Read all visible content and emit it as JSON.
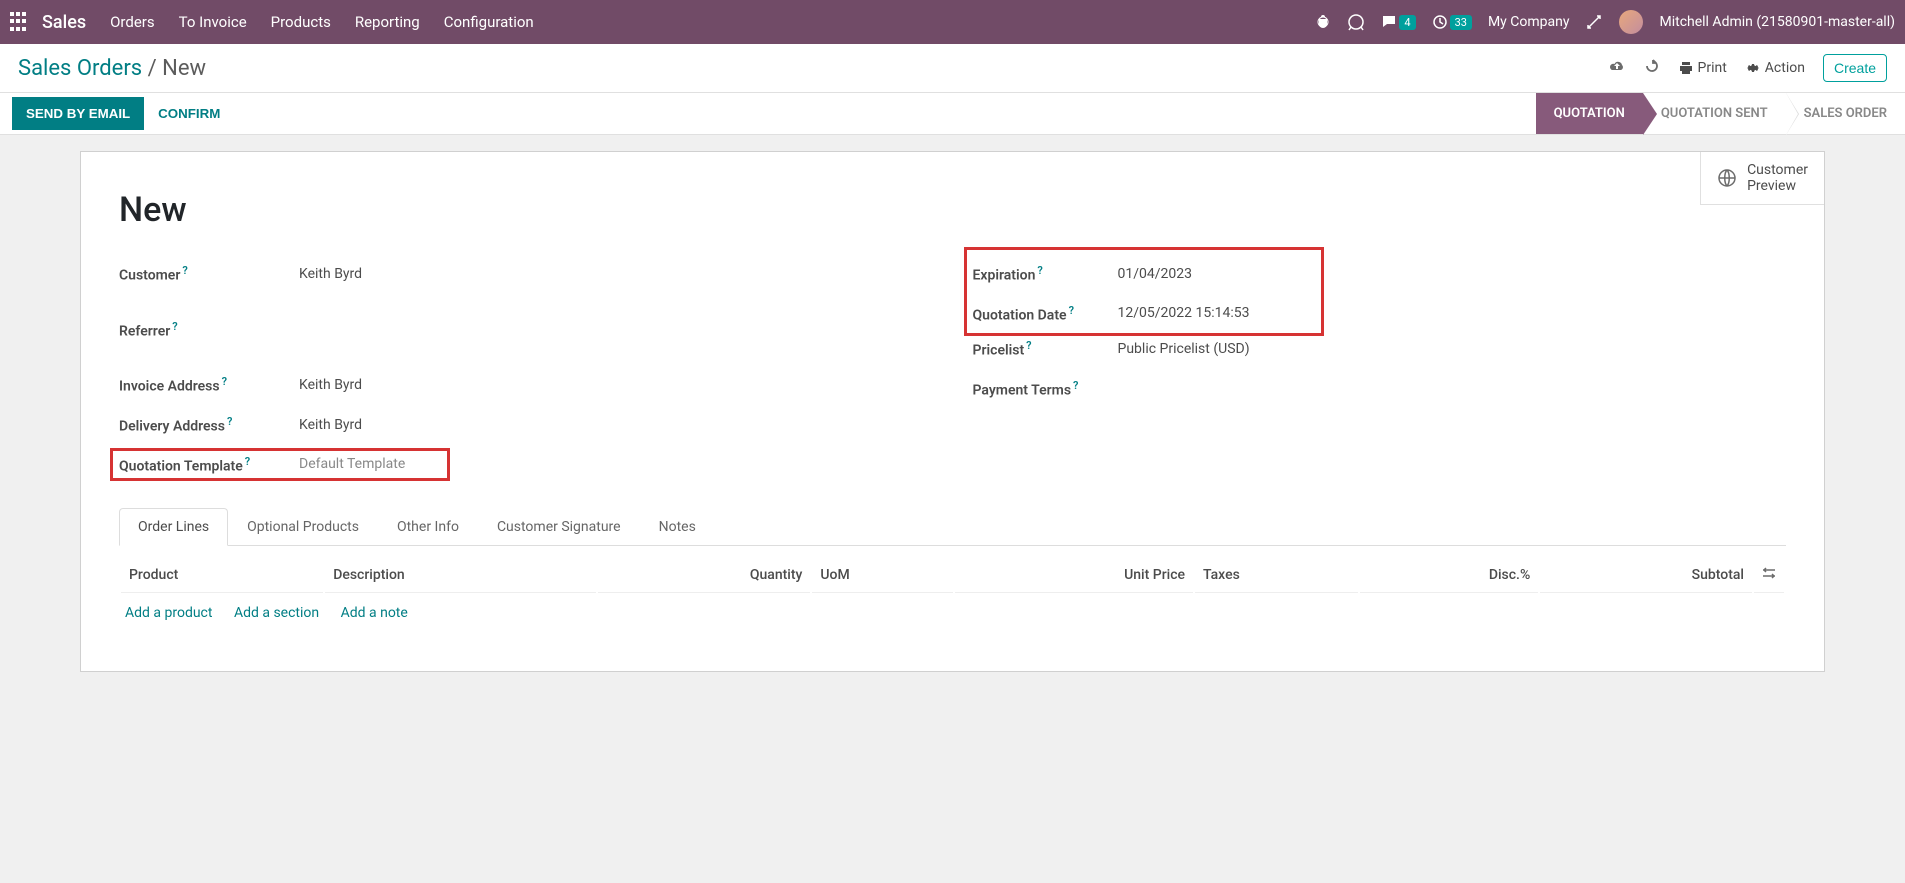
{
  "topbar": {
    "brand": "Sales",
    "nav": [
      "Orders",
      "To Invoice",
      "Products",
      "Reporting",
      "Configuration"
    ],
    "chat_count": "4",
    "activity_count": "33",
    "company": "My Company",
    "user": "Mitchell Admin (21580901-master-all)"
  },
  "breadcrumb": {
    "root": "Sales Orders",
    "current": "New"
  },
  "actions": {
    "print": "Print",
    "action": "Action",
    "create": "Create"
  },
  "buttons": {
    "send": "SEND BY EMAIL",
    "confirm": "CONFIRM"
  },
  "steps": [
    "QUOTATION",
    "QUOTATION SENT",
    "SALES ORDER"
  ],
  "preview": {
    "line1": "Customer",
    "line2": "Preview"
  },
  "form": {
    "title": "New",
    "left": {
      "customer_label": "Customer",
      "customer": "Keith Byrd",
      "referrer_label": "Referrer",
      "referrer": "",
      "invoice_label": "Invoice Address",
      "invoice": "Keith Byrd",
      "delivery_label": "Delivery Address",
      "delivery": "Keith Byrd",
      "template_label": "Quotation Template",
      "template": "Default Template"
    },
    "right": {
      "expiration_label": "Expiration",
      "expiration": "01/04/2023",
      "qdate_label": "Quotation Date",
      "qdate": "12/05/2022 15:14:53",
      "pricelist_label": "Pricelist",
      "pricelist": "Public Pricelist (USD)",
      "terms_label": "Payment Terms",
      "terms": ""
    }
  },
  "tabs": [
    "Order Lines",
    "Optional Products",
    "Other Info",
    "Customer Signature",
    "Notes"
  ],
  "columns": [
    "Product",
    "Description",
    "Quantity",
    "UoM",
    "Unit Price",
    "Taxes",
    "Disc.%",
    "Subtotal"
  ],
  "addlinks": {
    "product": "Add a product",
    "section": "Add a section",
    "note": "Add a note"
  }
}
